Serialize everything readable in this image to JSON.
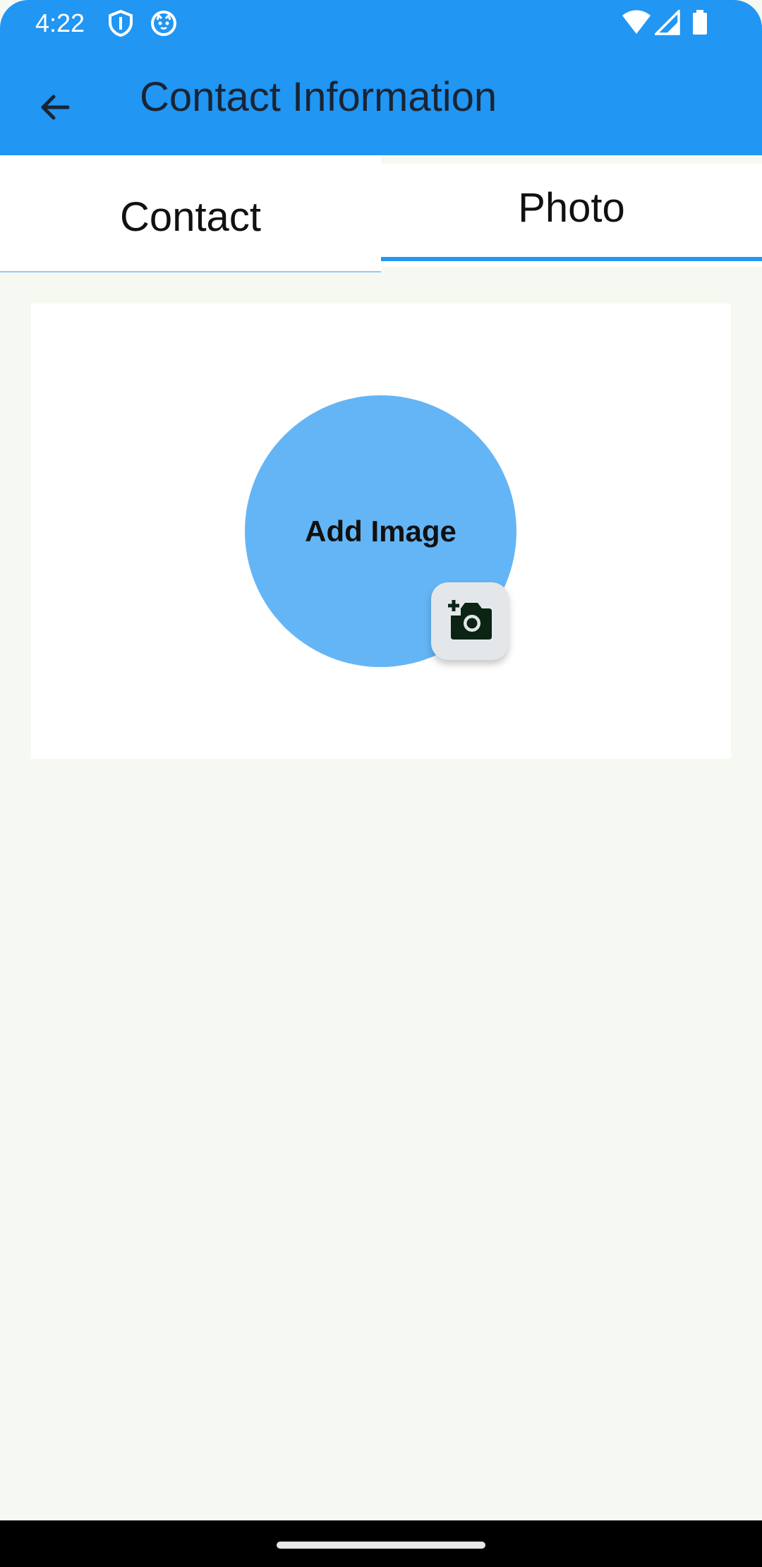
{
  "status_bar": {
    "time": "4:22",
    "icons": [
      "shield-icon",
      "cat-face-icon",
      "wifi-icon",
      "signal-icon",
      "battery-icon"
    ]
  },
  "toolbar": {
    "title": "Contact Information",
    "back_icon": "arrow-back-icon"
  },
  "tabs": [
    {
      "label": "Contact",
      "selected": false
    },
    {
      "label": "Photo",
      "selected": true
    }
  ],
  "photo_card": {
    "avatar_label": "Add Image",
    "add_photo_icon": "add-a-photo-icon"
  },
  "colors": {
    "primary": "#2196f3",
    "avatar": "#64b5f6",
    "background": "#f6f9f1"
  }
}
